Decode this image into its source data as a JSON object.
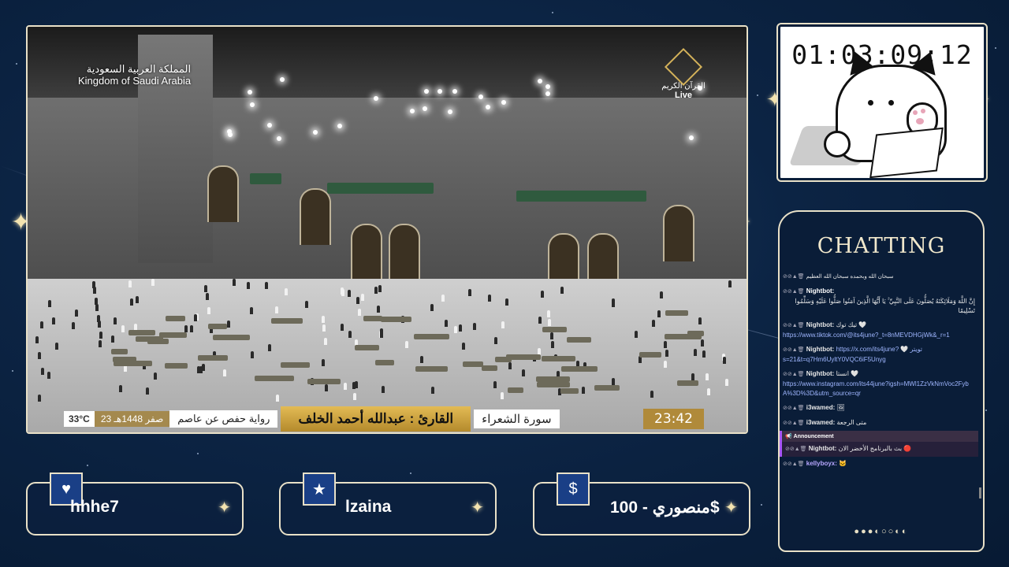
{
  "video": {
    "watermark_ar": "المملكة العربية السعودية",
    "watermark_en": "Kingdom of Saudi Arabia",
    "channel_logo_text": "القرآن الكريم",
    "live_label": "Live",
    "temperature": "33°C",
    "hijri_date": "23 صفر 1448هـ",
    "riwaya": "رواية حفص عن عاصم",
    "qari": "القارئ : عبدالله أحمد الخلف",
    "surah": "سورة الشعراء",
    "clock": "23:42"
  },
  "timer": {
    "value": "01:03:09:12"
  },
  "chat": {
    "title": "CHATTING",
    "messages": [
      {
        "user": "",
        "text": "سبحان الله وبحمده سبحان الله العظيم"
      },
      {
        "user": "Nightbot:",
        "text": "إِنَّ اللَّهَ وَمَلَائِكَتَهُ يُصَلُّونَ عَلَى النَّبِيِّ ۚ يَا أَيُّهَا الَّذِينَ آمَنُوا صَلُّوا عَلَيْهِ وَسَلِّمُوا تَسْلِيمًا"
      },
      {
        "user": "Nightbot:",
        "text": "تيك توك 🤍",
        "link": "https://www.tiktok.com/@its4june?_t=8nMEVDHGjWk&_r=1"
      },
      {
        "user": "Nightbot:",
        "text": "https://x.com/its4june? 🤍 تويتر",
        "link": "s=21&t=q7Hm6UyltY0VQC6iF5Unyg"
      },
      {
        "user": "Nightbot:",
        "text": "انستا 🤍",
        "link": "https://www.instagram.com/its44june?igsh=MWl1ZzVkNmVoc2FybA%3D%3D&utm_source=qr"
      },
      {
        "user": "i3wamed:",
        "text": ""
      },
      {
        "user": "i3wamed:",
        "text": "متى الرجعة"
      },
      {
        "user": "Nightbot:",
        "text": "بث بالبرنامج الأخضر الان 🔴"
      },
      {
        "user": "kellyboyx:",
        "text": ""
      }
    ],
    "announcement_label": "Announcement",
    "pager": "●●●◐○○◐◐"
  },
  "cards": [
    {
      "icon": "♥",
      "label": "hhhe7"
    },
    {
      "icon": "★",
      "label": "lzaina"
    },
    {
      "icon": "$",
      "label": "منصوري - 100$"
    }
  ],
  "colors": {
    "accent_gold": "#e3bb55",
    "panel_border": "#e9e1c8",
    "background": "#0c2444"
  }
}
